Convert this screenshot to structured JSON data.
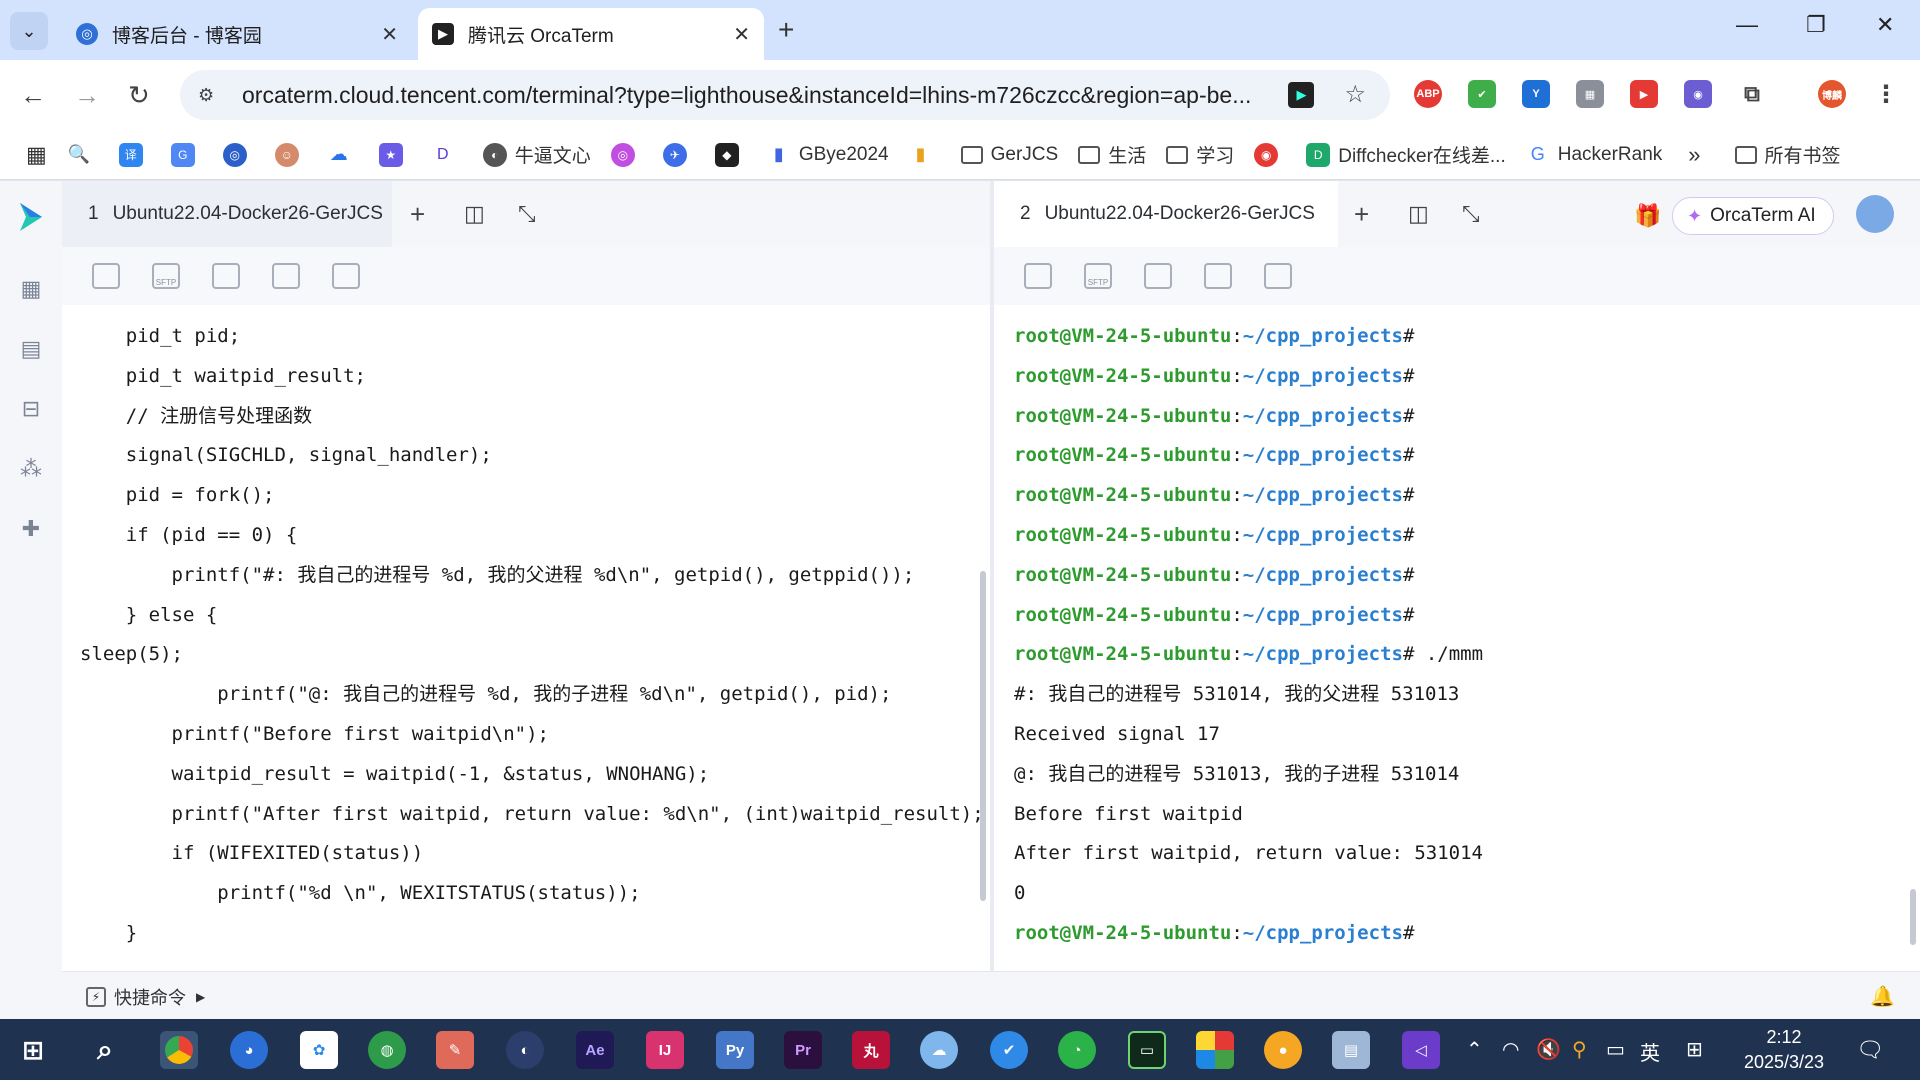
{
  "browser": {
    "tabs": [
      {
        "title": "博客后台 - 博客园",
        "active": false
      },
      {
        "title": "腾讯云 OrcaTerm",
        "active": true
      }
    ],
    "url": "orcaterm.cloud.tencent.com/terminal?type=lighthouse&instanceId=lhins-m726czcc&region=ap-be...",
    "bookmarks": [
      "牛逼文心",
      "GBye2024",
      "GerJCS",
      "生活",
      "学习",
      "Diffchecker在线差...",
      "HackerRank"
    ],
    "all_bookmarks": "所有书签",
    "profile_label": "博麟",
    "abp_label": "ABP"
  },
  "app": {
    "left_pane": {
      "index": "1",
      "title": "Ubuntu22.04-Docker26-GerJCS"
    },
    "right_pane": {
      "index": "2",
      "title": "Ubuntu22.04-Docker26-GerJCS"
    },
    "ai_button": "OrcaTerm AI",
    "quick_commands": "快捷命令",
    "sftp_label": "SFTP"
  },
  "left_terminal": [
    "    pid_t pid;",
    "    pid_t waitpid_result;",
    "    // 注册信号处理函数",
    "    signal(SIGCHLD, signal_handler);",
    "    pid = fork();",
    "    if (pid == 0) {",
    "        printf(\"#: 我自己的进程号 %d, 我的父进程 %d\\n\", getpid(), getppid());",
    "    } else {",
    "sleep(5);",
    "            printf(\"@: 我自己的进程号 %d, 我的子进程 %d\\n\", getpid(), pid);",
    "        printf(\"Before first waitpid\\n\");",
    "        waitpid_result = waitpid(-1, &status, WNOHANG);",
    "        printf(\"After first waitpid, return value: %d\\n\", (int)waitpid_result);",
    "        if (WIFEXITED(status))",
    "            printf(\"%d \\n\", WEXITSTATUS(status));",
    "    }"
  ],
  "right_terminal": {
    "prompt_user": "root@VM-24-5-ubuntu",
    "prompt_sep": ":",
    "prompt_path": "~/cpp_projects",
    "prompt_end": "#",
    "lines": [
      {
        "prompt": true,
        "cmd": ""
      },
      {
        "prompt": true,
        "cmd": ""
      },
      {
        "prompt": true,
        "cmd": ""
      },
      {
        "prompt": true,
        "cmd": ""
      },
      {
        "prompt": true,
        "cmd": ""
      },
      {
        "prompt": true,
        "cmd": ""
      },
      {
        "prompt": true,
        "cmd": ""
      },
      {
        "prompt": true,
        "cmd": ""
      },
      {
        "prompt": true,
        "cmd": " ./mmm"
      },
      {
        "prompt": false,
        "text": "#: 我自己的进程号 531014, 我的父进程 531013"
      },
      {
        "prompt": false,
        "text": "Received signal 17"
      },
      {
        "prompt": false,
        "text": "@: 我自己的进程号 531013, 我的子进程 531014"
      },
      {
        "prompt": false,
        "text": "Before first waitpid"
      },
      {
        "prompt": false,
        "text": "After first waitpid, return value: 531014"
      },
      {
        "prompt": false,
        "text": "0"
      },
      {
        "prompt": true,
        "cmd": ""
      }
    ]
  },
  "taskbar": {
    "ime": "英",
    "time": "2:12",
    "date": "2025/3/23",
    "apps": [
      "Ae",
      "Pr",
      "丸"
    ]
  },
  "colors": {
    "prompt_user": "#2e9b2e",
    "prompt_path": "#2a7fd0",
    "taskbar": "#1f3350",
    "tabstrip": "#d3e3fd"
  }
}
